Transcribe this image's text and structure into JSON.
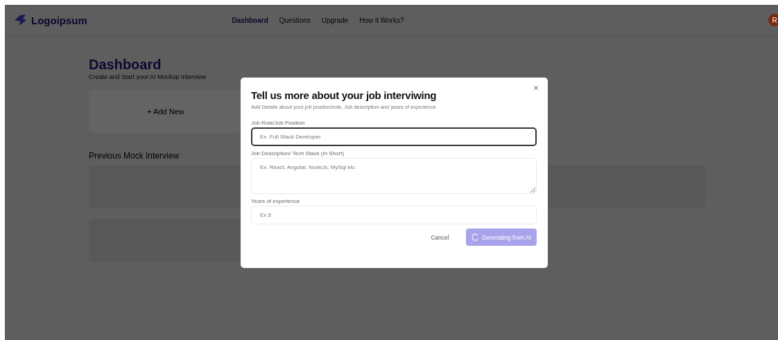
{
  "header": {
    "logo": "Logoipsum",
    "nav": [
      {
        "label": "Dashboard",
        "selected": true
      },
      {
        "label": "Questions",
        "selected": false
      },
      {
        "label": "Upgrade",
        "selected": false
      },
      {
        "label": "How it Works?",
        "selected": false
      }
    ],
    "avatar": "R"
  },
  "dashboard": {
    "title": "Dashboard",
    "subtitle": "Create and Start your AI Mockup Interview",
    "add_new": "+ Add New",
    "previous_title": "Previous Mock Interview"
  },
  "dialog": {
    "title": "Tell us more about your job interviwing",
    "description": "Add Details about yout job position/role, Job description and years of experience",
    "fields": [
      {
        "kind": "input",
        "label": "Job Role/Job Position",
        "placeholder": "Ex. Full Stack Developer",
        "focused": true
      },
      {
        "kind": "textarea",
        "label": "Job Description/ Tech Stack (In Short)",
        "placeholder": "Ex. React, Angular, NodeJs, MySql etc",
        "focused": false
      },
      {
        "kind": "input",
        "label": "Years of experience",
        "placeholder": "Ex.5",
        "focused": false
      }
    ],
    "cancel": "Cancel",
    "submit": {
      "label": "Generating from AI",
      "loading": true
    }
  }
}
